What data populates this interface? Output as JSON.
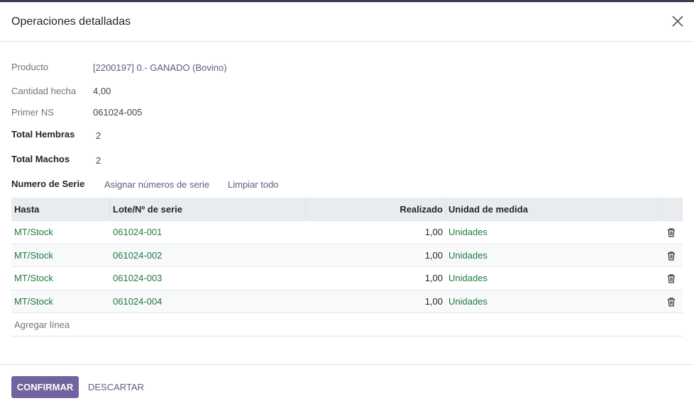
{
  "dialog": {
    "title": "Operaciones detalladas",
    "close_icon": "close-icon"
  },
  "fields": {
    "producto": {
      "label": "Producto",
      "value": "[2200197] 0.- GANADO (Bovino)"
    },
    "cantidad": {
      "label": "Cantidad hecha",
      "value": "4,00"
    },
    "primer_ns": {
      "label": "Primer NS",
      "value": "061024-005"
    },
    "hembras": {
      "label": "Total Hembras",
      "value": "2"
    },
    "machos": {
      "label": "Total Machos",
      "value": "2"
    }
  },
  "serial_section": {
    "title": "Numero de Serie",
    "assign_link": "Asignar números de serie",
    "clear_link": "Limpiar todo"
  },
  "table": {
    "columns": [
      "Hasta",
      "Lote/Nº de serie",
      "Realizado",
      "Unidad de medida"
    ],
    "rows": [
      {
        "hasta": "MT/Stock",
        "lote": "061024-001",
        "realizado": "1,00",
        "unidad": "Unidades"
      },
      {
        "hasta": "MT/Stock",
        "lote": "061024-002",
        "realizado": "1,00",
        "unidad": "Unidades"
      },
      {
        "hasta": "MT/Stock",
        "lote": "061024-003",
        "realizado": "1,00",
        "unidad": "Unidades"
      },
      {
        "hasta": "MT/Stock",
        "lote": "061024-004",
        "realizado": "1,00",
        "unidad": "Unidades"
      }
    ],
    "add_line": "Agregar línea",
    "row_delete_icon": "trash-icon"
  },
  "footer": {
    "confirm": "Confirmar",
    "discard": "Descartar"
  },
  "colors": {
    "primary": "#71639e",
    "link": "#5f5d80",
    "green_text": "#1f7a3f"
  }
}
